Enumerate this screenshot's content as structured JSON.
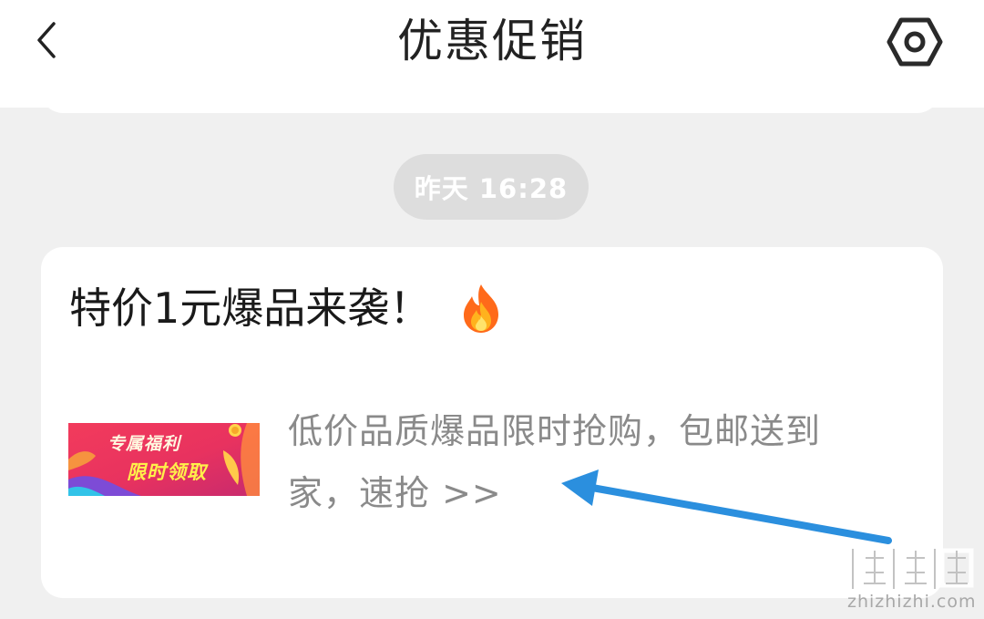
{
  "header": {
    "title": "优惠促销",
    "back_icon": "chevron-left-icon",
    "settings_icon": "hexagon-settings-icon"
  },
  "timestamp": "昨天 16:28",
  "message": {
    "title": "特价1元爆品来袭！",
    "title_icon": "fire-icon",
    "banner": {
      "line1": "专属福利",
      "line2": "限时领取"
    },
    "body": "低价品质爆品限时抢购，包邮送到家，速抢 >>"
  },
  "watermark": {
    "mark": "值值值",
    "site": "zhizhizhi.com"
  },
  "colors": {
    "background": "#f0f0f0",
    "card": "#ffffff",
    "pill": "#dddddd",
    "annotation_arrow": "#2b8fde",
    "body_text": "#8a8a8a"
  }
}
